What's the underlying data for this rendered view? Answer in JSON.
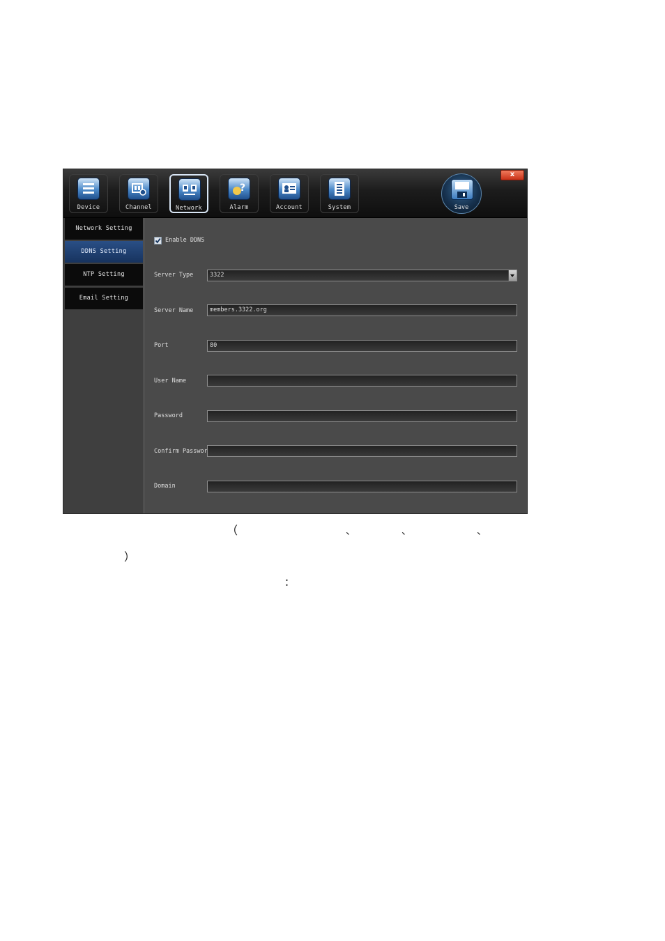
{
  "window": {
    "close_label": "x"
  },
  "toolbar": {
    "items": [
      {
        "label": "Device"
      },
      {
        "label": "Channel"
      },
      {
        "label": "Network"
      },
      {
        "label": "Alarm"
      },
      {
        "label": "Account"
      },
      {
        "label": "System"
      }
    ],
    "save_label": "Save",
    "active": "Network"
  },
  "sidebar": {
    "items": [
      {
        "label": "Network Setting"
      },
      {
        "label": "DDNS Setting"
      },
      {
        "label": "NTP Setting"
      },
      {
        "label": "Email Setting"
      }
    ],
    "active": "DDNS Setting"
  },
  "form": {
    "enable_ddns": {
      "label": "Enable DDNS",
      "checked": true
    },
    "server_type": {
      "label": "Server Type",
      "value": "3322"
    },
    "server_name": {
      "label": "Server Name",
      "value": "members.3322.org"
    },
    "port": {
      "label": "Port",
      "value": "80"
    },
    "user_name": {
      "label": "User Name",
      "value": ""
    },
    "password": {
      "label": "Password",
      "value": ""
    },
    "confirm_password": {
      "label": "Confirm Password",
      "value": ""
    },
    "domain": {
      "label": "Domain",
      "value": ""
    }
  },
  "page_text": {
    "open_paren": "（",
    "comma1": "、",
    "comma2": "、",
    "comma3": "、",
    "close_paren": "）",
    "colon": "："
  }
}
